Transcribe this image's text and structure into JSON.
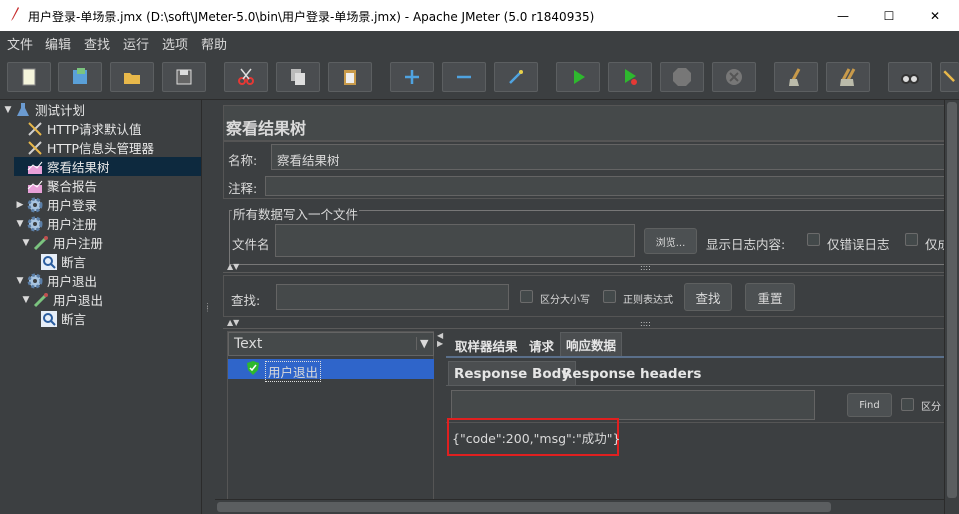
{
  "window": {
    "title": "用户登录-单场景.jmx (D:\\soft\\JMeter-5.0\\bin\\用户登录-单场景.jmx) - Apache JMeter (5.0 r1840935)"
  },
  "menu": [
    "文件",
    "编辑",
    "查找",
    "运行",
    "选项",
    "帮助"
  ],
  "toolbar": [
    "new-icon",
    "templates-icon",
    "open-icon",
    "save-icon",
    "cut-icon",
    "copy-icon",
    "paste-icon",
    "expand-icon",
    "collapse-icon",
    "toggle-icon",
    "start-icon",
    "start-no-pause-icon",
    "stop-icon",
    "shutdown-icon",
    "clear-icon",
    "clear-all-icon",
    "search-icon",
    "reset-search-icon"
  ],
  "tree": [
    {
      "label": "测试计划",
      "toggle": "▼",
      "icon": "flask-icon",
      "level": 0
    },
    {
      "label": "HTTP请求默认值",
      "toggle": "",
      "icon": "wrench-icon",
      "level": 1
    },
    {
      "label": "HTTP信息头管理器",
      "toggle": "",
      "icon": "wrench-icon",
      "level": 1
    },
    {
      "label": "察看结果树",
      "toggle": "",
      "icon": "chart-icon",
      "level": 1,
      "selected": true
    },
    {
      "label": "聚合报告",
      "toggle": "",
      "icon": "chart-icon",
      "level": 1
    },
    {
      "label": "用户登录",
      "toggle": "▶",
      "icon": "gear-icon",
      "level": 1
    },
    {
      "label": "用户注册",
      "toggle": "▼",
      "icon": "gear-icon",
      "level": 1
    },
    {
      "label": "用户注册",
      "toggle": "▼",
      "icon": "pipette-icon",
      "level": 2
    },
    {
      "label": "断言",
      "toggle": "",
      "icon": "magnifier-icon",
      "level": 3
    },
    {
      "label": "用户退出",
      "toggle": "▼",
      "icon": "gear-icon",
      "level": 1
    },
    {
      "label": "用户退出",
      "toggle": "▼",
      "icon": "pipette-icon",
      "level": 2
    },
    {
      "label": "断言",
      "toggle": "",
      "icon": "magnifier-icon",
      "level": 3
    }
  ],
  "panel": {
    "title": "察看结果树",
    "name_label": "名称:",
    "name_value": "察看结果树",
    "comment_label": "注释:",
    "comment_value": "",
    "file_section": "所有数据写入一个文件",
    "filename_label": "文件名",
    "browse_button": "浏览...",
    "log_label": "显示日志内容:",
    "errors_only": "仅错误日志",
    "success_only": "仅成"
  },
  "search": {
    "label": "查找:",
    "case_sensitive": "区分大小写",
    "regex": "正则表达式",
    "find_button": "查找",
    "reset_button": "重置"
  },
  "renderer": {
    "selected": "Text"
  },
  "results": [
    {
      "label": "用户退出",
      "status": "success"
    }
  ],
  "tabs": {
    "main": [
      "取样器结果",
      "请求",
      "响应数据"
    ],
    "sub": [
      "Response Body",
      "Response headers"
    ]
  },
  "response": {
    "find_button": "Find",
    "case_label": "区分",
    "body": "{\"code\":200,\"msg\":\"成功\"}"
  }
}
